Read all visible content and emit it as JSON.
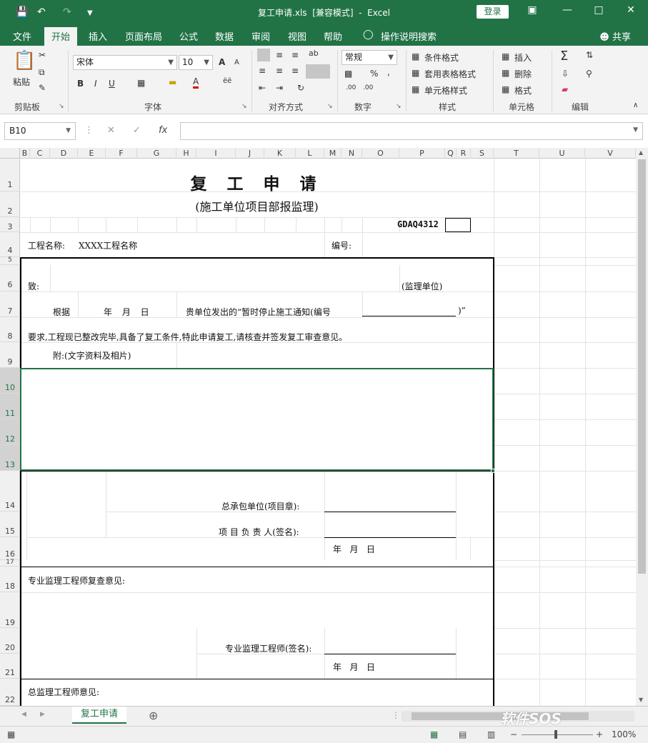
{
  "titlebar": {
    "filename": "复工申请.xls",
    "mode": "[兼容模式]",
    "app": "Excel",
    "login_label": "登录"
  },
  "ribbon_tabs": [
    "文件",
    "开始",
    "插入",
    "页面布局",
    "公式",
    "数据",
    "审阅",
    "视图",
    "帮助",
    "操作说明搜索"
  ],
  "active_tab": "开始",
  "share_label": "共享",
  "ribbon": {
    "clipboard": {
      "paste": "粘贴",
      "group": "剪贴板"
    },
    "font": {
      "family": "宋体",
      "size": "10",
      "bold": "B",
      "italic": "I",
      "underline": "U",
      "group": "字体",
      "grow": "A",
      "shrink": "A",
      "font_color": "A"
    },
    "alignment": {
      "group": "对齐方式"
    },
    "number": {
      "format": "常规",
      "percent": "%",
      "comma": ",",
      "group": "数字"
    },
    "styles": {
      "conditional": "条件格式",
      "table": "套用表格格式",
      "cell": "单元格样式",
      "group": "样式"
    },
    "cells": {
      "insert": "插入",
      "delete": "删除",
      "format": "格式",
      "group": "单元格"
    },
    "editing": {
      "group": "编辑"
    }
  },
  "formula_bar": {
    "name_box": "B10",
    "fx": "fx",
    "content": ""
  },
  "columns": [
    "B",
    "C",
    "D",
    "E",
    "F",
    "G",
    "H",
    "I",
    "J",
    "K",
    "L",
    "M",
    "N",
    "O",
    "P",
    "Q",
    "R",
    "S",
    "T",
    "U",
    "V"
  ],
  "rows": [
    "1",
    "2",
    "3",
    "4",
    "5",
    "6",
    "7",
    "8",
    "9",
    "10",
    "11",
    "12",
    "13",
    "14",
    "15",
    "16",
    "17",
    "18",
    "19",
    "20",
    "21",
    "22"
  ],
  "document": {
    "title": "复 工 申 请",
    "subtitle": "(施工单位项目部报监理)",
    "code": "GDAQ4312",
    "project_label": "工程名称:",
    "project_name": "XXXX工程名称",
    "number_label": "编号:",
    "to_label": "致:",
    "supervisor_unit": "(监理单位)",
    "basis": "根据",
    "date_ymd_tight": "年 月 日",
    "notice_text": "贵单位发出的“暂时停止施工通知(编号",
    "notice_close": ")”",
    "request_text": "要求,工程现已整改完毕,具备了复工条件,特此申请复工,请核查并签发复工审查意见。",
    "attachment": "附:(文字资料及相片)",
    "contractor_label": "总承包单位(项目章):",
    "manager_label": "项 目 负 责 人(签名):",
    "date_ymd": "年   月   日",
    "engineer_opinion": "专业监理工程师复查意见:",
    "engineer_sign": "专业监理工程师(签名):",
    "chief_opinion": "总监理工程师意见:"
  },
  "sheet_tab": "复工申请",
  "status": {
    "zoom": "100%"
  },
  "watermark": "软件SOS"
}
